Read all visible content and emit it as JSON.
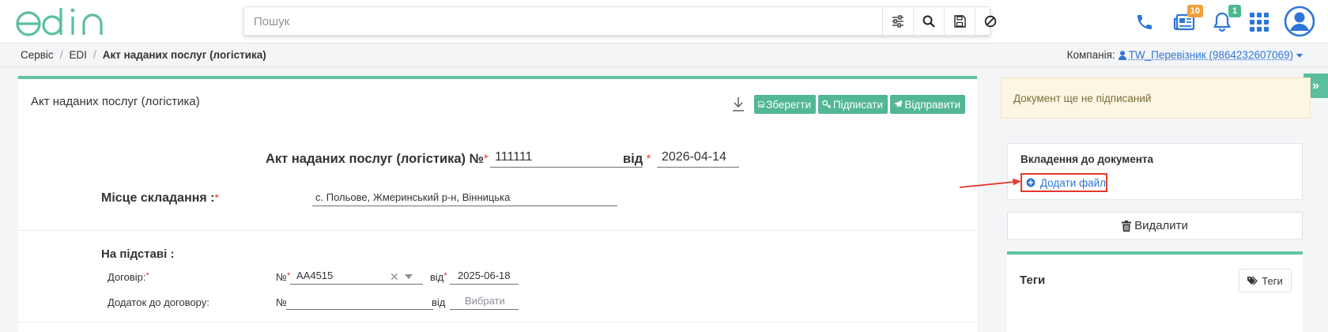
{
  "header": {
    "logo_text": "edin",
    "search": {
      "placeholder": "Пошук"
    },
    "icons": [
      "sliders-icon",
      "search-icon",
      "save-icon",
      "block-icon",
      "phone-icon",
      "news-icon",
      "bell-icon",
      "apps-grid-icon",
      "user-avatar-icon"
    ],
    "news_badge": "10",
    "notifications_badge": "1"
  },
  "breadcrumb": {
    "items": [
      "Сервіс",
      "EDI"
    ],
    "current": "Акт наданих послуг (логістика)"
  },
  "company": {
    "label": "Компанія:",
    "value": "TW_Перевізник (9864232607069)"
  },
  "document": {
    "card_title": "Акт наданих послуг (логістика)",
    "buttons": {
      "save": "Зберегти",
      "sign": "Підписати",
      "send": "Відправити"
    },
    "heading": "Акт наданих послуг (логістика) №",
    "number": "111111",
    "from_label": "від",
    "date": "2026-04-14",
    "place_label": "Місце складання :",
    "place_value": "с. Польове, Жмеринський р-н, Вінницька",
    "basis_label": "На підставі :",
    "contract": {
      "label": "Договір:",
      "no_label": "№",
      "number": "АА4515",
      "from_label": "від",
      "date": "2025-06-18"
    },
    "addendum": {
      "label": "Додаток до договору:",
      "no_label": "№",
      "from_label": "від",
      "date_placeholder": "Вибрати"
    },
    "required_mark": "*"
  },
  "sidebar": {
    "status_message": "Документ ще не підписаний",
    "attachments_title": "Вкладення до документа",
    "add_file": "Додати файл",
    "delete": "Видалити",
    "tags_title": "Теги",
    "tags_button": "Теги",
    "collapse_icon": "»"
  },
  "colors": {
    "accent": "#52b794",
    "link": "#2e75d8",
    "warning_bg": "#fcf6e3",
    "highlight": "#e23a2f",
    "badge_orange": "#f0a03a",
    "badge_green": "#4cb88f"
  }
}
